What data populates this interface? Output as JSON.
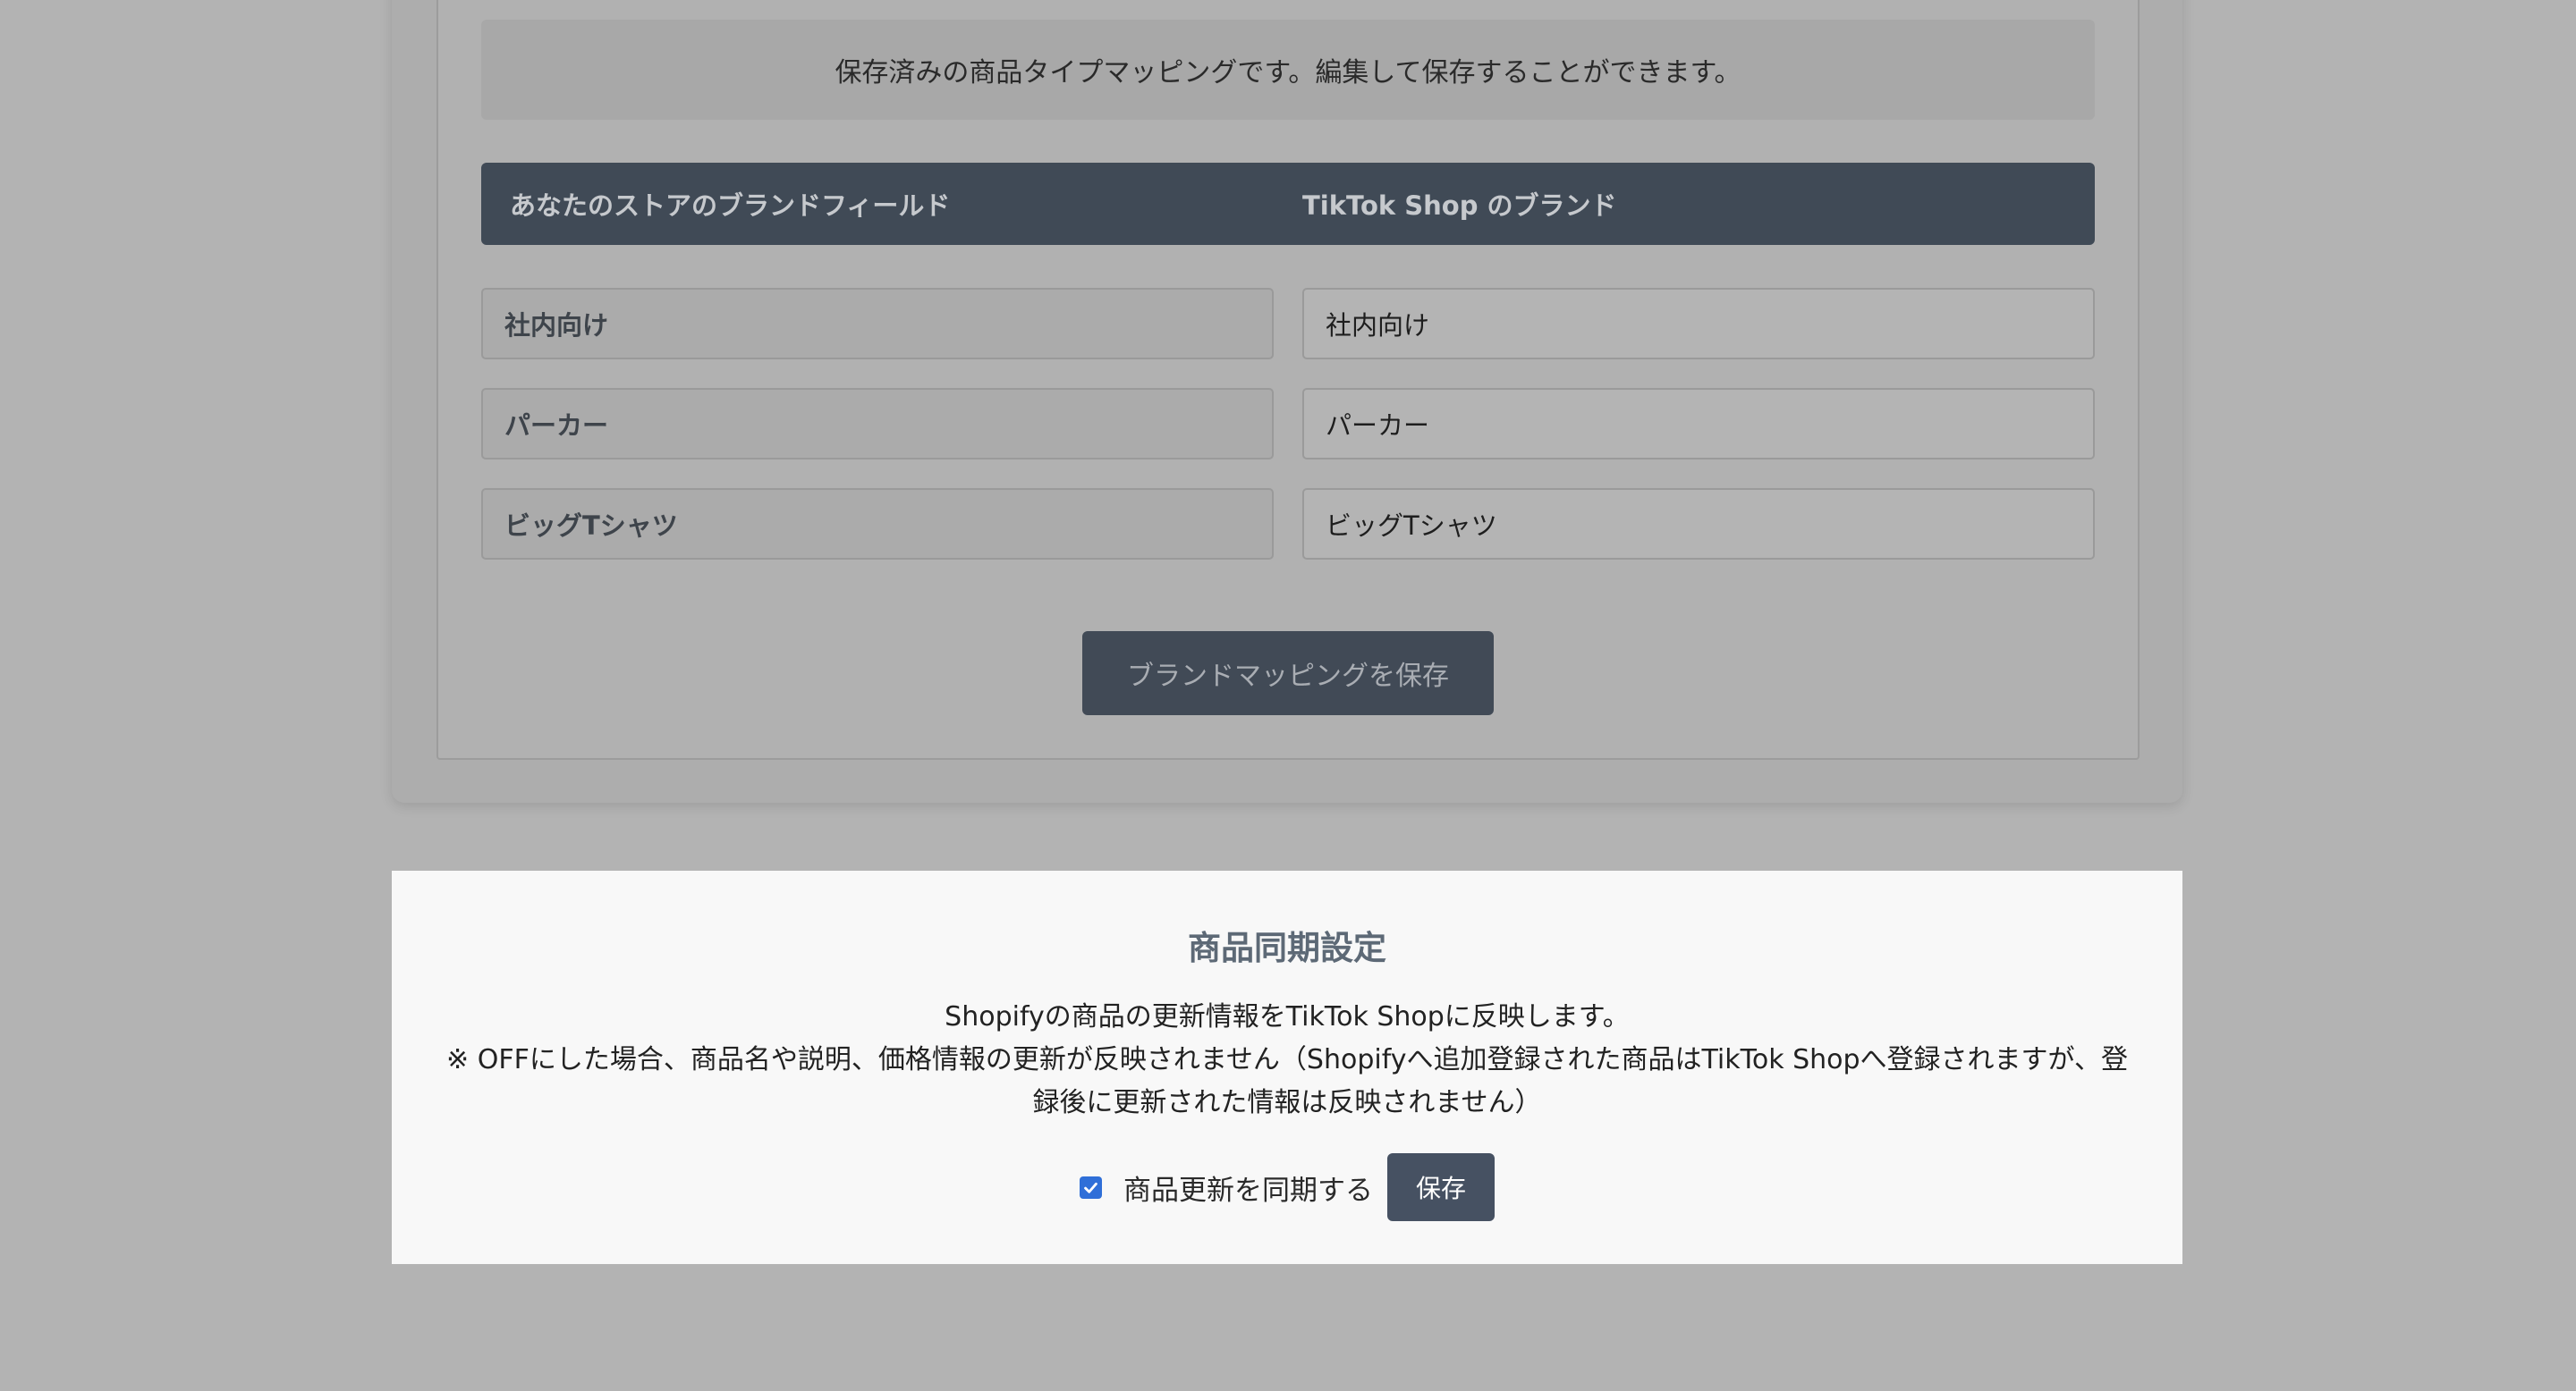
{
  "brand_mapping": {
    "notice": "保存済みの商品タイプマッピングです。編集して保存することができます。",
    "header_store_field": "あなたのストアのブランドフィールド",
    "header_tiktok_brand": "TikTok Shop のブランド",
    "rows": [
      {
        "store_value": "社内向け",
        "tiktok_value": "社内向け"
      },
      {
        "store_value": "パーカー",
        "tiktok_value": "パーカー"
      },
      {
        "store_value": "ビッグTシャツ",
        "tiktok_value": "ビッグTシャツ"
      }
    ],
    "save_button": "ブランドマッピングを保存"
  },
  "product_sync": {
    "title": "商品同期設定",
    "description_line1": "Shopifyの商品の更新情報をTikTok Shopに反映します。",
    "description_line2": "※ OFFにした場合、商品名や説明、価格情報の更新が反映されません（Shopifyへ追加登録された商品はTikTok Shopへ登録されますが、登録後に更新された情報は反映されません）",
    "checkbox_label": "商品更新を同期する",
    "checkbox_checked": true,
    "save_button": "保存"
  },
  "colors": {
    "accent_dark": "#404a56",
    "checkbox_blue": "#2f6fd8",
    "overlay_gray": "#b3b3b3"
  }
}
